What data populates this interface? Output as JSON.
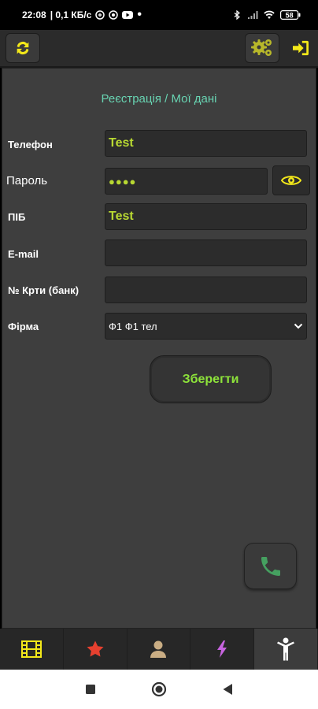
{
  "status_bar": {
    "time": "22:08",
    "net_speed": "| 0,1 КБ/с",
    "battery": "58"
  },
  "form": {
    "title": "Реєстрація / Мої дані",
    "fields": [
      {
        "label": "Телефон",
        "value": "Test"
      },
      {
        "label": "Пароль",
        "value": "●●●●"
      },
      {
        "label": "ПІБ",
        "value": "Test"
      },
      {
        "label": "E-mail",
        "value": ""
      },
      {
        "label": "№ Крти (банк)",
        "value": ""
      },
      {
        "label": "Фірма",
        "value": "Ф1 Ф1 тел"
      }
    ],
    "save_label": "Зберегти"
  },
  "colors": {
    "accent_green": "#8ee43a",
    "value_yellow_green": "#b8d832",
    "title_teal": "#68d4b2",
    "icon_yellow": "#f3e81a"
  },
  "icons": {
    "toolbar": [
      "refresh-icon",
      "settings-gears-icon",
      "sign-in-icon"
    ],
    "tabs": [
      "film-icon",
      "star-icon",
      "user-icon",
      "lightning-icon",
      "person-icon"
    ],
    "nav": [
      "square-icon",
      "circle-icon",
      "back-triangle-icon"
    ]
  }
}
